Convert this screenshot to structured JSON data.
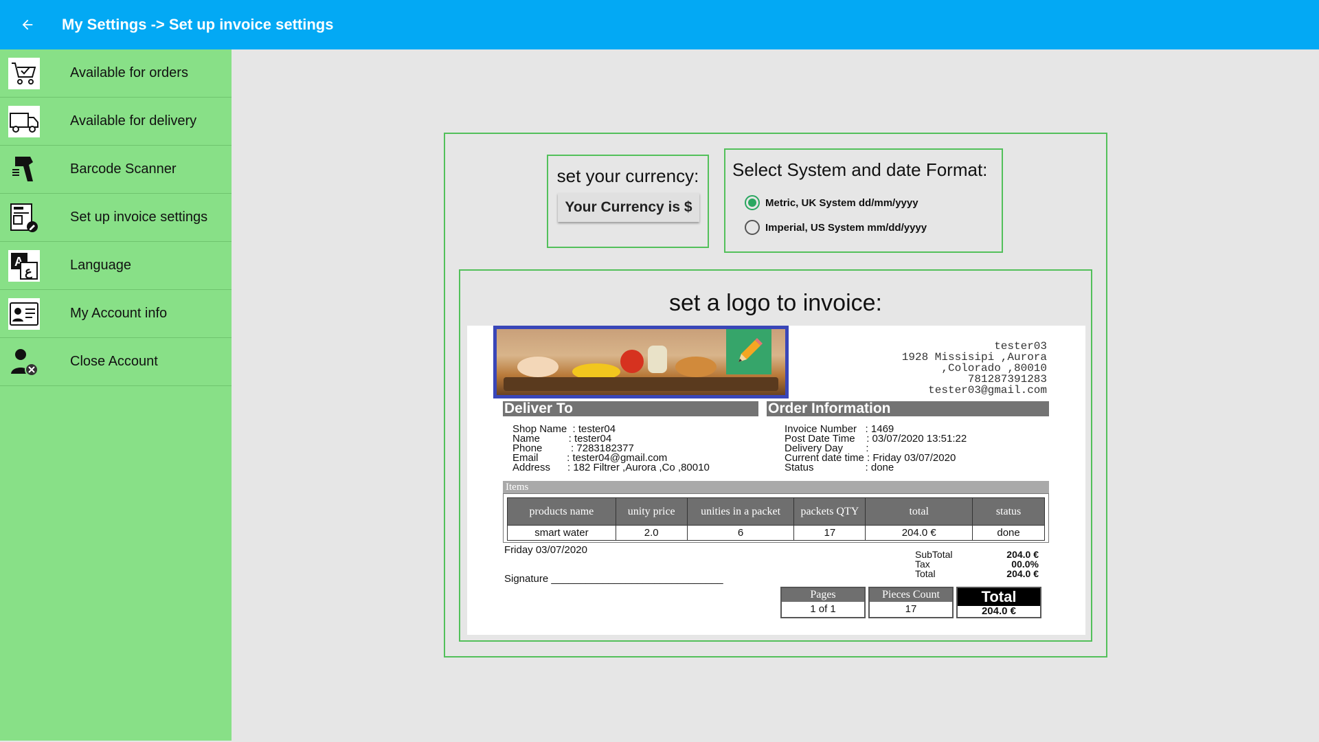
{
  "header": {
    "title": "My Settings -> Set up invoice settings",
    "back_icon": "arrow-left-icon"
  },
  "sidebar": {
    "items": [
      {
        "label": "Available for orders",
        "icon": "cart-check-icon"
      },
      {
        "label": "Available for delivery",
        "icon": "truck-icon"
      },
      {
        "label": "Barcode Scanner",
        "icon": "barcode-scanner-icon"
      },
      {
        "label": "Set up invoice settings",
        "icon": "invoice-edit-icon"
      },
      {
        "label": "Language",
        "icon": "translate-icon"
      },
      {
        "label": "My Account info",
        "icon": "id-card-icon"
      },
      {
        "label": "Close Account",
        "icon": "user-remove-icon"
      }
    ]
  },
  "currency": {
    "title": "set your currency:",
    "button_label": "Your Currency is $"
  },
  "date_format": {
    "title": "Select System and date Format:",
    "options": [
      {
        "label": "Metric, UK System  dd/mm/yyyy",
        "selected": true
      },
      {
        "label": "Imperial, US System  mm/dd/yyyy",
        "selected": false
      }
    ]
  },
  "logo": {
    "title": "set a logo to invoice:",
    "edit_icon": "pencil-icon"
  },
  "invoice": {
    "seller": [
      "tester03",
      "1928 Missisipi ,Aurora",
      ",Colorado ,80010",
      "781287391283",
      "tester03@gmail.com"
    ],
    "deliver_heading": "Deliver To",
    "order_heading": "Order Information",
    "deliver_lines": [
      "Shop Name  : tester04",
      "Name          : tester04",
      "Phone          : 7283182377",
      "Email          : tester04@gmail.com",
      "Address      : 182 Filtrer ,Aurora ,Co ,80010"
    ],
    "order_lines": [
      "Invoice Number   : 1469",
      "Post Date Time    : 03/07/2020 13:51:22",
      "Delivery Day        :",
      "Current date time : Friday 03/07/2020",
      "Status                  : done"
    ],
    "items_label": "Items",
    "columns": [
      "products name",
      "unity price",
      "unities in a packet",
      "packets QTY",
      "total",
      "status"
    ],
    "rows": [
      [
        "smart water",
        "2.0",
        "6",
        "17",
        "204.0 €",
        "done"
      ]
    ],
    "date_text": "Friday 03/07/2020",
    "signature_text": "Signature ______________________________",
    "subtotal_label": "SubTotal",
    "subtotal_value": "204.0 €",
    "tax_label": "Tax",
    "tax_value": "00.0%",
    "total_label": "Total",
    "total_value": "204.0 €",
    "pages_label": "Pages",
    "pages_value": "1 of 1",
    "pieces_label": "Pieces Count",
    "pieces_value": "17",
    "grand_total_label": "Total",
    "grand_total_value": "204.0 €"
  }
}
